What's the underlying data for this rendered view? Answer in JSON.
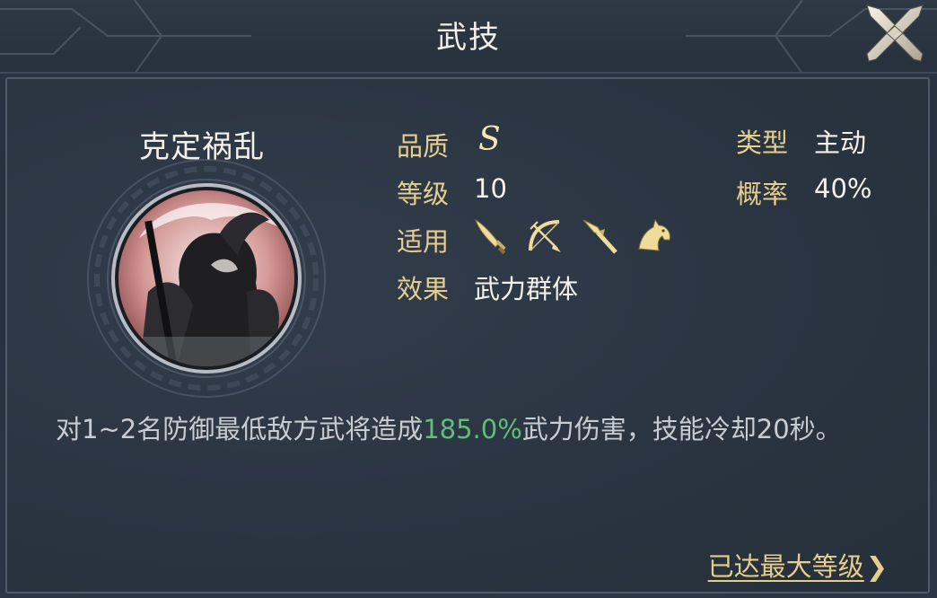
{
  "header": {
    "title": "武技"
  },
  "skill": {
    "name": "克定祸乱",
    "attributes": {
      "quality_label": "品质",
      "quality_value": "S",
      "level_label": "等级",
      "level_value": "10",
      "applicable_label": "适用",
      "effect_label": "效果",
      "effect_value": "武力群体",
      "type_label": "类型",
      "type_value": "主动",
      "rate_label": "概率",
      "rate_value": "40%"
    },
    "applicable_icons": [
      "sword-icon",
      "bow-icon",
      "spear-icon",
      "horse-icon"
    ],
    "description_before": "对1~2名防御最低敌方武将造成",
    "description_highlight": "185.0%",
    "description_after": "武力伤害，技能冷却20秒。"
  },
  "footer": {
    "max_level_label": "已达最大等级",
    "max_level_arrow": "❯"
  },
  "colors": {
    "label": "#e6cf8e",
    "value": "#f4f1ea",
    "highlight": "#5fbf79",
    "background": "#2a3441"
  }
}
